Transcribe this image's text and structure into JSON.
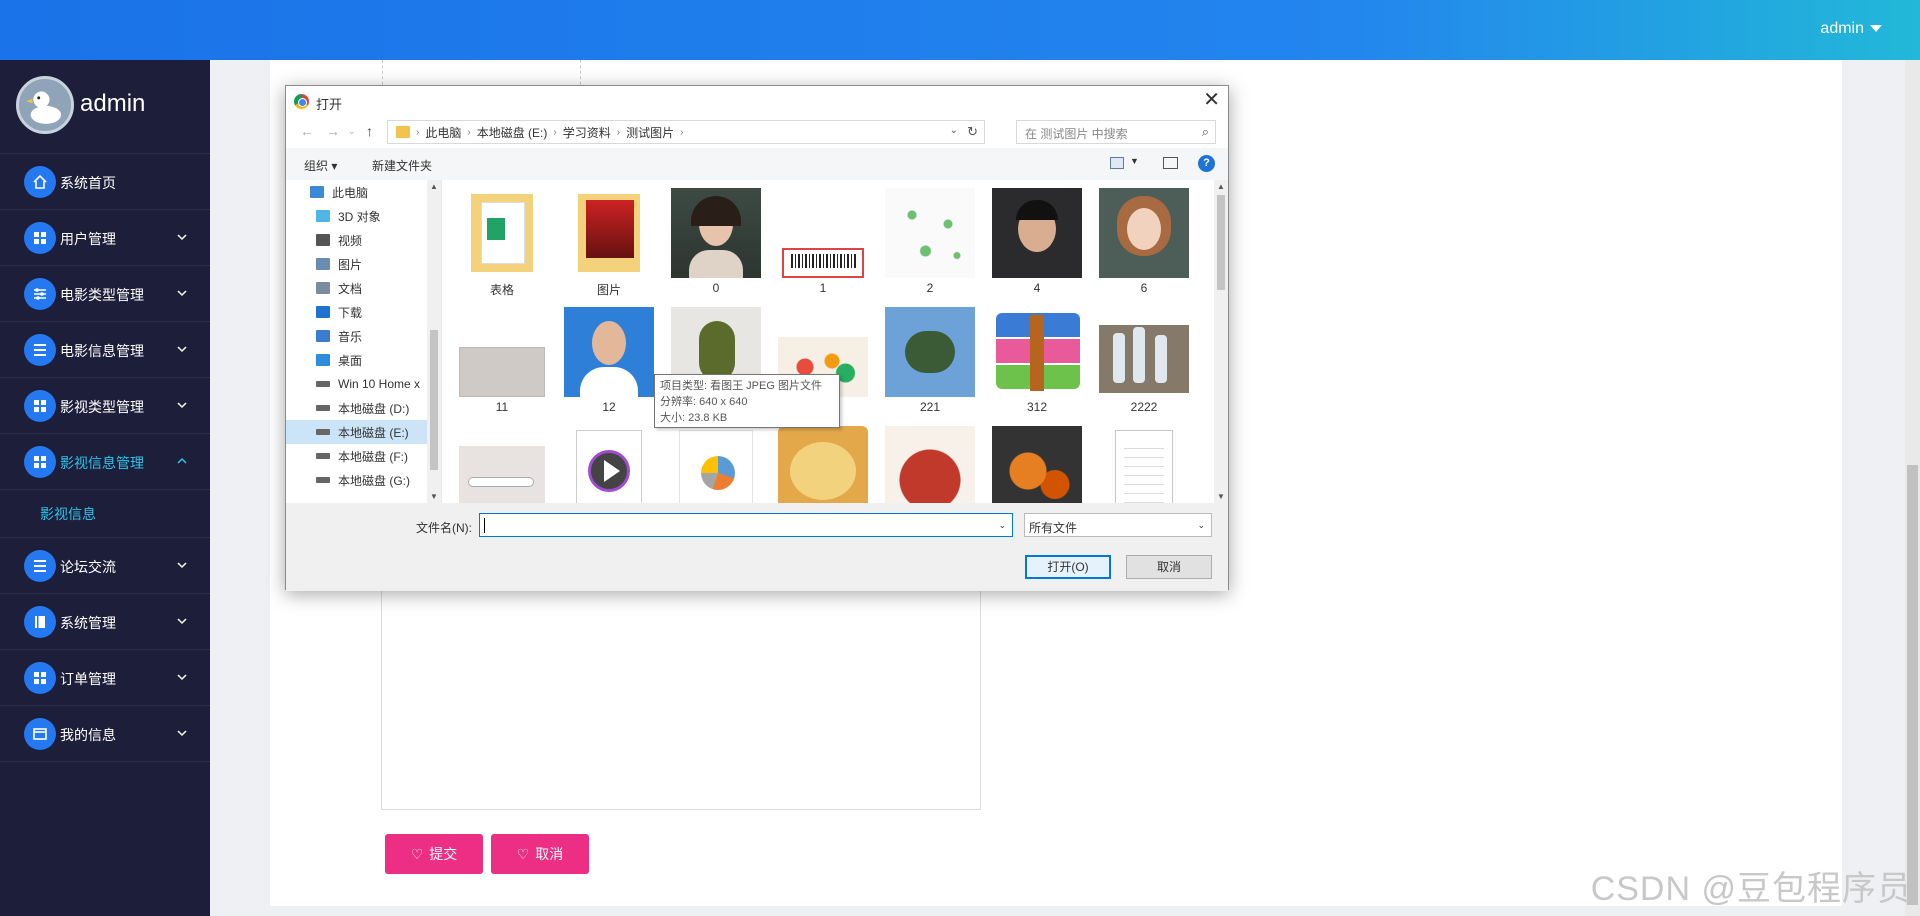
{
  "topbar": {
    "user": "admin"
  },
  "sidebar": {
    "brand": "admin",
    "items": [
      {
        "label": "系统首页",
        "icon": "home-icon",
        "expandable": false
      },
      {
        "label": "用户管理",
        "icon": "grid-icon",
        "expandable": true
      },
      {
        "label": "电影类型管理",
        "icon": "sliders-icon",
        "expandable": true
      },
      {
        "label": "电影信息管理",
        "icon": "list-icon",
        "expandable": true
      },
      {
        "label": "影视类型管理",
        "icon": "grid-icon",
        "expandable": true
      },
      {
        "label": "影视信息管理",
        "icon": "grid-icon",
        "expandable": true,
        "active": true
      }
    ],
    "submenu": "影视信息",
    "items_after": [
      {
        "label": "论坛交流",
        "icon": "list-icon",
        "expandable": true
      },
      {
        "label": "系统管理",
        "icon": "book-icon",
        "expandable": true
      },
      {
        "label": "订单管理",
        "icon": "grid-icon",
        "expandable": true
      },
      {
        "label": "我的信息",
        "icon": "card-icon",
        "expandable": true
      }
    ]
  },
  "form": {
    "submit_label": "提交",
    "cancel_label": "取消"
  },
  "watermark": "CSDN @豆包程序员",
  "dialog": {
    "title": "打开",
    "path": [
      "此电脑",
      "本地磁盘 (E:)",
      "学习资料",
      "测试图片"
    ],
    "search_placeholder": "在 测试图片 中搜索",
    "toolbar": {
      "organize": "组织",
      "new_folder": "新建文件夹"
    },
    "nav": [
      {
        "label": "此电脑",
        "icon": "computer-icon",
        "indent": 0
      },
      {
        "label": "3D 对象",
        "icon": "cube-icon",
        "indent": 1
      },
      {
        "label": "视频",
        "icon": "video-icon",
        "indent": 1
      },
      {
        "label": "图片",
        "icon": "picture-icon",
        "indent": 1
      },
      {
        "label": "文档",
        "icon": "document-icon",
        "indent": 1
      },
      {
        "label": "下载",
        "icon": "download-icon",
        "indent": 1
      },
      {
        "label": "音乐",
        "icon": "music-icon",
        "indent": 1
      },
      {
        "label": "桌面",
        "icon": "desktop-icon",
        "indent": 1
      },
      {
        "label": "Win 10 Home x",
        "icon": "drive-icon",
        "indent": 1
      },
      {
        "label": "本地磁盘 (D:)",
        "icon": "drive-icon",
        "indent": 1
      },
      {
        "label": "本地磁盘 (E:)",
        "icon": "drive-icon",
        "indent": 1,
        "selected": true
      },
      {
        "label": "本地磁盘 (F:)",
        "icon": "drive-icon",
        "indent": 1
      },
      {
        "label": "本地磁盘 (G:)",
        "icon": "drive-icon",
        "indent": 1
      }
    ],
    "files": [
      {
        "name": "表格",
        "kind": "folder-excel"
      },
      {
        "name": "图片",
        "kind": "folder-photo"
      },
      {
        "name": "0",
        "kind": "portrait-woman"
      },
      {
        "name": "1",
        "kind": "barcode"
      },
      {
        "name": "2",
        "kind": "network"
      },
      {
        "name": "4",
        "kind": "portrait-man"
      },
      {
        "name": "6",
        "kind": "portrait-girl"
      },
      {
        "name": "11",
        "kind": "certificate"
      },
      {
        "name": "12",
        "kind": "id-photo"
      },
      {
        "name": "",
        "kind": "beetle-green"
      },
      {
        "name": "",
        "kind": "salad"
      },
      {
        "name": "221",
        "kind": "beetle"
      },
      {
        "name": "312",
        "kind": "winrar"
      },
      {
        "name": "2222",
        "kind": "bottles"
      },
      {
        "name": "",
        "kind": "airplane"
      },
      {
        "name": "",
        "kind": "video-play"
      },
      {
        "name": "",
        "kind": "pie-chart"
      },
      {
        "name": "",
        "kind": "food-plate"
      },
      {
        "name": "",
        "kind": "crayfish"
      },
      {
        "name": "",
        "kind": "shrimp"
      },
      {
        "name": "",
        "kind": "text-document"
      }
    ],
    "tooltip": {
      "type": "项目类型: 看图王 JPEG 图片文件",
      "resolution": "分辨率: 640 x 640",
      "size": "大小: 23.8 KB"
    },
    "filename_label": "文件名(N):",
    "filename_value": "",
    "filetype": "所有文件",
    "open_label": "打开(O)",
    "cancel_label": "取消"
  },
  "colors": {
    "accent": "#2478f0",
    "sidebar_bg": "#1d1e3a",
    "active_text": "#2cc4e8",
    "pink_button": "#ec2f84"
  }
}
